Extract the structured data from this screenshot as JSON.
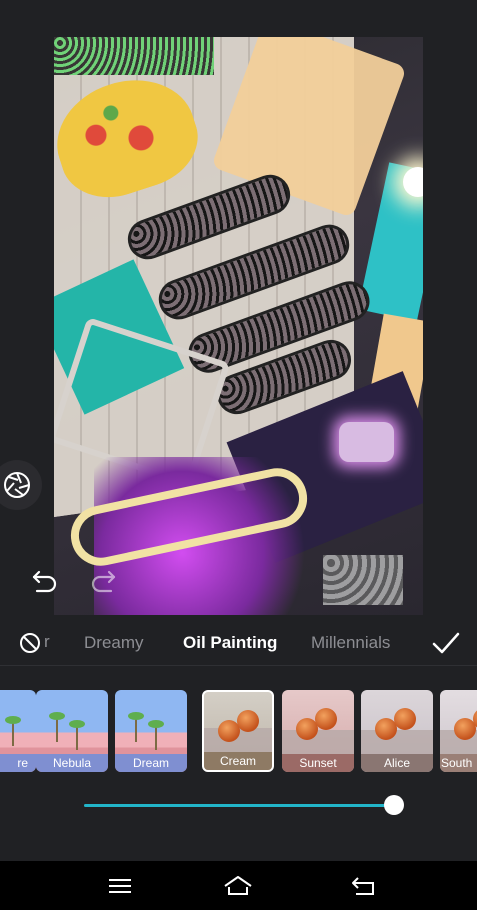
{
  "app": {
    "accent_color": "#22b5c9",
    "background_color": "#202124"
  },
  "toolbar": {
    "camera_icon": "shutter-icon",
    "undo_icon": "undo-icon",
    "redo_icon": "redo-icon"
  },
  "filter_categories": {
    "none_icon": "no-filter-icon",
    "partial_label": "r",
    "tabs": [
      {
        "label": "Dreamy",
        "active": false
      },
      {
        "label": "Oil Painting",
        "active": true
      },
      {
        "label": "Millennials",
        "active": false
      }
    ],
    "confirm_icon": "checkmark-icon"
  },
  "filters": [
    {
      "label": "re",
      "style": "beach",
      "selected": false
    },
    {
      "label": "Nebula",
      "style": "beach",
      "selected": false
    },
    {
      "label": "Dream",
      "style": "beach",
      "selected": false
    },
    {
      "label": "Cream",
      "style": "fruit",
      "selected": true
    },
    {
      "label": "Sunset",
      "style": "fruit",
      "selected": false
    },
    {
      "label": "Alice",
      "style": "fruit",
      "selected": false
    },
    {
      "label": "South",
      "style": "fruit",
      "selected": false
    }
  ],
  "intensity": {
    "value": 1.0
  },
  "system_nav": {
    "menu_icon": "menu-icon",
    "home_icon": "home-icon",
    "back_icon": "back-icon"
  }
}
